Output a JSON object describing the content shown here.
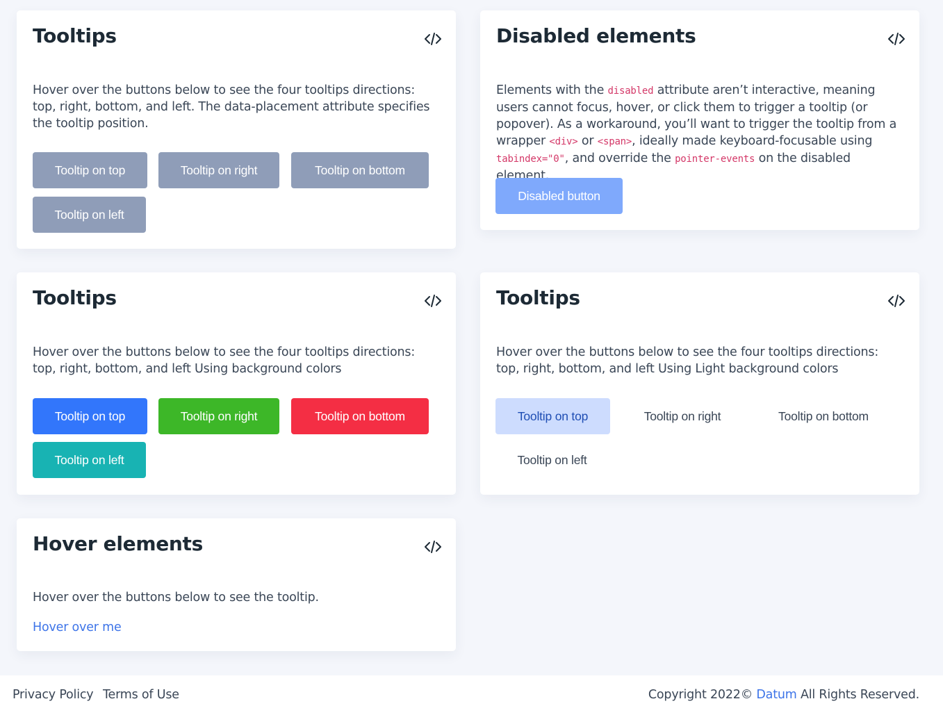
{
  "colors": {
    "page_bg": "#f4f6fb",
    "gray": "#8f9db8",
    "primary": "#3276fb",
    "success": "#3db728",
    "danger": "#f42e44",
    "info": "#18b3b3",
    "disabled": "#7fa9fc",
    "light_primary": "#cddcfe",
    "link": "#3d74e8",
    "code": "#d43868"
  },
  "code_icon": "code-brackets-icon",
  "card1": {
    "title": "Tooltips",
    "text": "Hover over the buttons below to see the four tooltips directions: top, right, bottom, and left. The data-placement attribute specifies the tooltip position.",
    "buttons": [
      "Tooltip on top",
      "Tooltip on right",
      "Tooltip on bottom",
      "Tooltip on left"
    ]
  },
  "card2": {
    "title": "Disabled elements",
    "text_parts": {
      "p1": "Elements with the ",
      "c1": "disabled",
      "p2": " attribute aren’t interactive, meaning users cannot focus, hover, or click them to trigger a tooltip (or popover). As a workaround, you’ll want to trigger the tooltip from a wrapper ",
      "c2": "<div>",
      "p3": " or ",
      "c3": "<span>",
      "p4": ", ideally made keyboard-focusable using ",
      "c4": "tabindex=\"0\"",
      "p5": ", and override the ",
      "c5": "pointer-events",
      "p6": " on the disabled element."
    },
    "button": "Disabled button"
  },
  "card3": {
    "title": "Tooltips",
    "text": "Hover over the buttons below to see the four tooltips directions: top, right, bottom, and left Using background colors",
    "buttons": [
      "Tooltip on top",
      "Tooltip on right",
      "Tooltip on bottom",
      "Tooltip on left"
    ]
  },
  "card4": {
    "title": "Tooltips",
    "text": "Hover over the buttons below to see the four tooltips directions: top, right, bottom, and left Using Light background colors",
    "buttons": [
      "Tooltip on top",
      "Tooltip on right",
      "Tooltip on bottom",
      "Tooltip on left"
    ]
  },
  "card5": {
    "title": "Hover elements",
    "text": "Hover over the buttons below to see the tooltip.",
    "link": "Hover over me"
  },
  "footer": {
    "privacy": "Privacy Policy",
    "terms": "Terms of Use",
    "copyright_prefix": "Copyright 2022© ",
    "brand": "Datum",
    "copyright_suffix": " All Rights Reserved."
  }
}
